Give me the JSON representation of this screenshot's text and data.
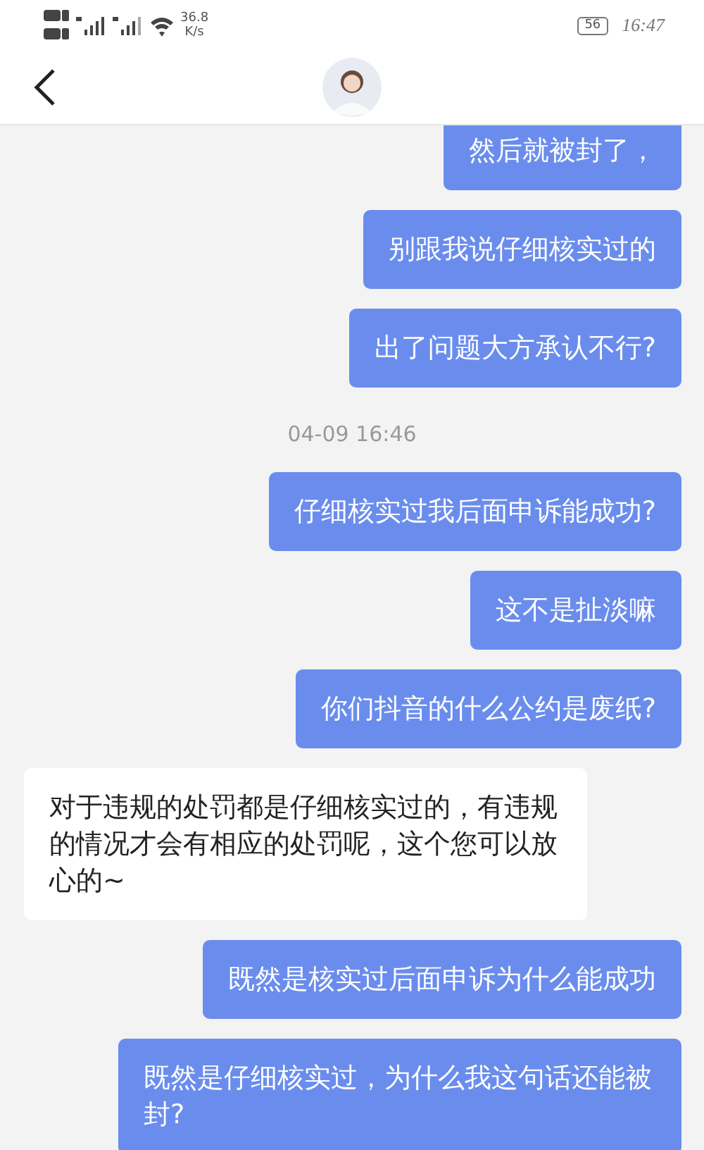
{
  "status_bar": {
    "network_speed": "36.8",
    "speed_unit": "K/s",
    "battery": "56",
    "time": "16:47"
  },
  "messages": [
    {
      "kind": "outgoing",
      "text": "然后就被封了，"
    },
    {
      "kind": "outgoing",
      "text": "别跟我说仔细核实过的"
    },
    {
      "kind": "outgoing",
      "text": "出了问题大方承认不行?"
    },
    {
      "kind": "timestamp",
      "text": "04-09 16:46"
    },
    {
      "kind": "outgoing",
      "text": "仔细核实过我后面申诉能成功?"
    },
    {
      "kind": "outgoing",
      "text": "这不是扯淡嘛"
    },
    {
      "kind": "outgoing",
      "text": "你们抖音的什么公约是废纸?"
    },
    {
      "kind": "incoming",
      "text": "对于违规的处罚都是仔细核实过的，有违规的情况才会有相应的处罚呢，这个您可以放心的~"
    },
    {
      "kind": "outgoing",
      "text": "既然是核实过后面申诉为什么能成功"
    },
    {
      "kind": "outgoing",
      "text": "既然是仔细核实过，为什么我这句话还能被封?"
    }
  ]
}
